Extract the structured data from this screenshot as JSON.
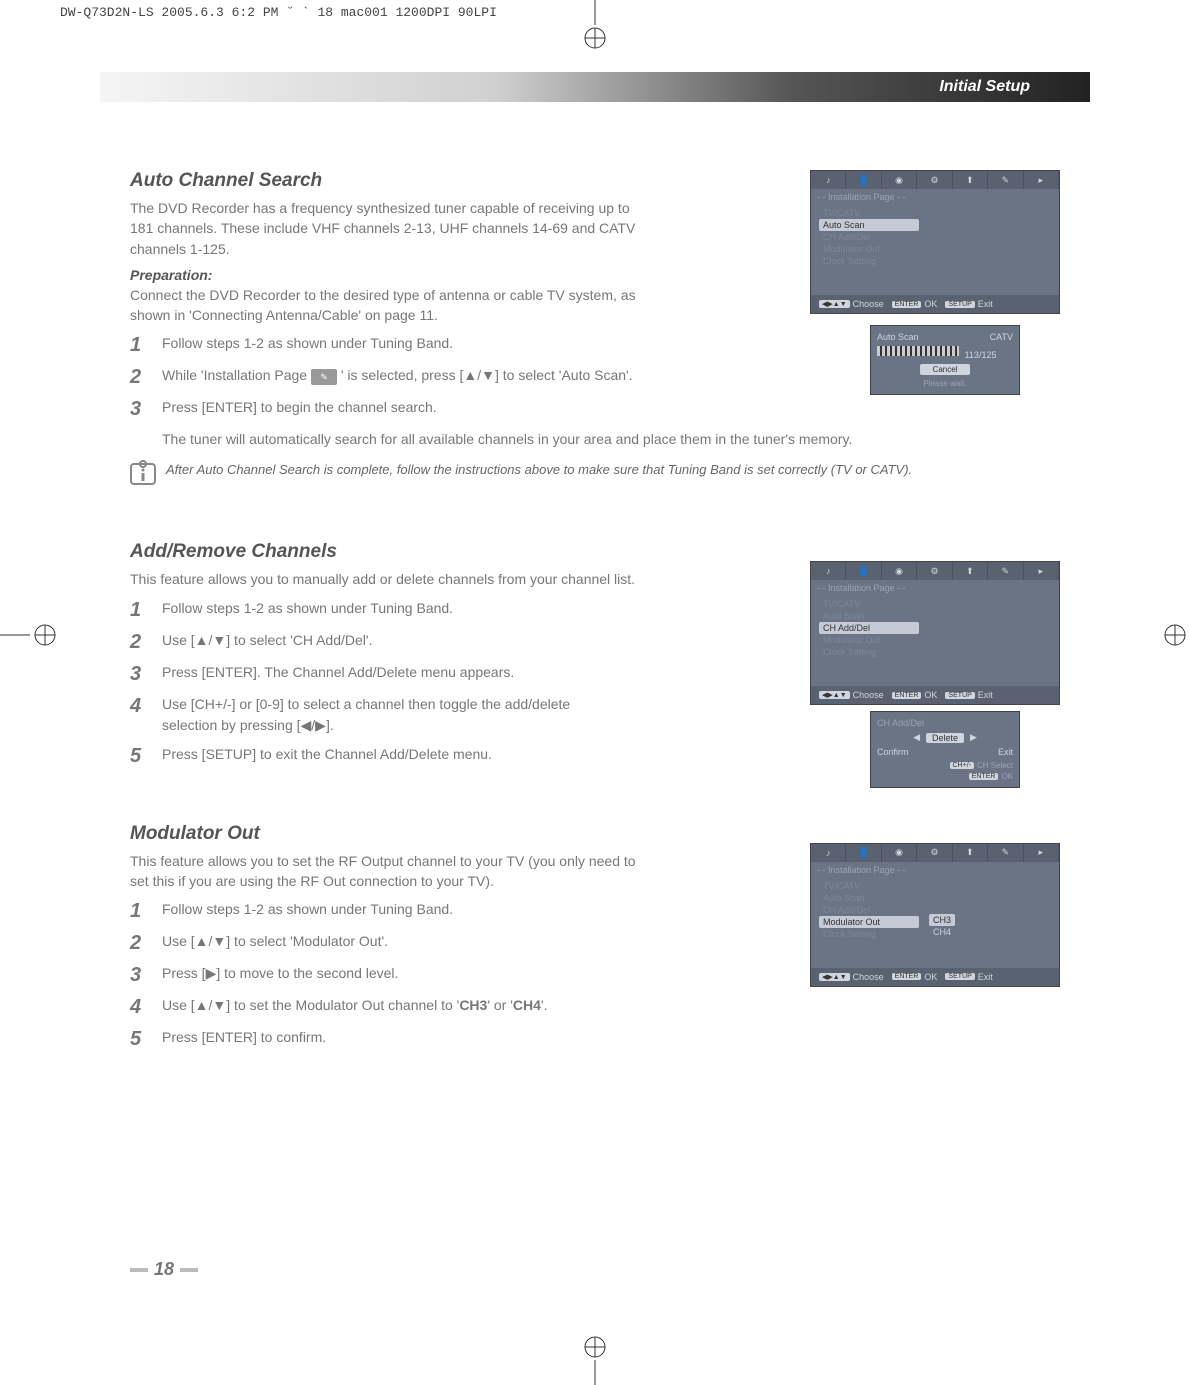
{
  "top_meta": "DW-Q73D2N-LS  2005.6.3 6:2 PM  ˘   `  18   mac001  1200DPI 90LPI",
  "header": {
    "title": "Initial Setup"
  },
  "page_number": "18",
  "sec1": {
    "title": "Auto Channel Search",
    "intro_line1": "The DVD Recorder has a frequency synthesized tuner capable of receiving up to 181 channels. These include VHF channels 2-13, UHF channels 14-69 and CATV channels 1-125.",
    "prep_label": "Preparation:",
    "prep_text": "Connect the DVD Recorder to the desired type of antenna or cable TV system, as shown in 'Connecting Antenna/Cable' on page 11.",
    "step1": "Follow steps 1-2 as shown under Tuning Band.",
    "step2_a": "While 'Installation Page ",
    "step2_b": " ' is selected, press [▲/▼] to select 'Auto Scan'.",
    "step3": "Press [ENTER] to begin the channel search.",
    "step3_sub": "The tuner will automatically search for all available channels in your area and place them in the tuner's memory.",
    "note": "After Auto Channel Search is complete, follow the instructions above to make sure that Tuning Band is set correctly (TV or CATV)."
  },
  "sec2": {
    "title": "Add/Remove Channels",
    "intro": "This feature allows you to manually add or delete channels from your channel list.",
    "step1": "Follow steps 1-2 as shown under Tuning Band.",
    "step2": "Use [▲/▼] to select 'CH Add/Del'.",
    "step3": "Press [ENTER]. The Channel Add/Delete menu appears.",
    "step4": "Use [CH+/-] or [0-9] to select a channel then toggle the add/delete selection by pressing [◀/▶].",
    "step5": "Press [SETUP] to exit the Channel Add/Delete menu."
  },
  "sec3": {
    "title": "Modulator Out",
    "intro": "This feature allows you to set the RF Output channel to your TV (you only need to set this if you are using the RF Out connection to your TV).",
    "step1": "Follow steps 1-2 as shown under Tuning Band.",
    "step2": "Use [▲/▼] to select 'Modulator Out'.",
    "step3": "Press [▶] to move to the second level.",
    "step4_a": "Use [▲/▼] to set the Modulator Out channel to '",
    "step4_b": "CH3",
    "step4_c": "' or '",
    "step4_d": "CH4",
    "step4_e": "'.",
    "step5": "Press [ENTER] to confirm."
  },
  "osd": {
    "page_label": "- - Installation Page - -",
    "menu": {
      "tv_catv": "TV/CATV",
      "auto_scan": "Auto Scan",
      "ch_add_del": "CH Add/Del",
      "modulator_out": "Modulator Out",
      "clock_setting": "Clock Setting"
    },
    "footer": {
      "choose": "Choose",
      "ok": "OK",
      "exit": "Exit",
      "enter_key": "ENTER",
      "setup_key": "SETUP"
    },
    "scan_popup": {
      "title": "Auto Scan",
      "source": "CATV",
      "progress": "113/125",
      "cancel": "Cancel",
      "wait": "Please wait."
    },
    "add_popup": {
      "title": "CH Add/Del",
      "delete": "Delete",
      "confirm": "Confirm",
      "exit": "Exit",
      "ch_select": "CH Select",
      "ok": "OK"
    },
    "mod_options": {
      "ch3": "CH3",
      "ch4": "CH4"
    }
  }
}
